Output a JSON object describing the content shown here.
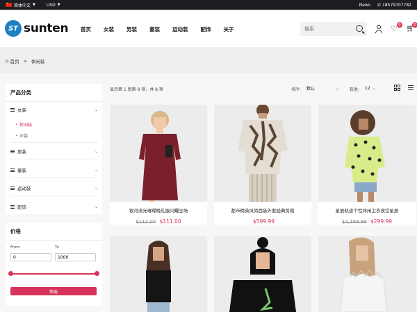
{
  "topbar": {
    "language": "简体中文",
    "currency": "USD",
    "news": "News",
    "phone": "18579707782"
  },
  "header": {
    "logo_mark": "ST",
    "logo_text": "sunten",
    "nav": [
      "首页",
      "女装",
      "男装",
      "童装",
      "运动装",
      "配饰",
      "关于"
    ],
    "search_placeholder": "搜索",
    "wishlist_count": "0",
    "cart_count": "0"
  },
  "breadcrumb": {
    "home": "首页",
    "separator": ">",
    "current": "休闲装"
  },
  "sidebar": {
    "categories_title": "产品分类",
    "categories": [
      {
        "label": "女装",
        "children": [
          {
            "label": "休闲装",
            "active": true
          },
          {
            "label": "正装",
            "active": false
          }
        ]
      },
      {
        "label": "男装"
      },
      {
        "label": "童装"
      },
      {
        "label": "运动装"
      },
      {
        "label": "配饰"
      }
    ],
    "price_title": "价格",
    "from_label": "From",
    "to_label": "To",
    "from_value": "0",
    "to_value": "1000",
    "filter_button": "筛选"
  },
  "toolbar": {
    "results_text": "显示第 1 到第 8 项，共 8 项",
    "sort_label": "排序:",
    "sort_value": "默认",
    "qty_label": "数量:",
    "qty_value": "12"
  },
  "products": [
    {
      "name": "银河流光璀璨晚礼服闪耀全场",
      "old_price": "$112.00",
      "price": "$111.00"
    },
    {
      "name": "都市精英风尚西装外套经典剪裁",
      "old_price": "",
      "price": "$599.99"
    },
    {
      "name": "星辰轨迹个性休闲卫衣夜空星辰",
      "old_price": "$2,199.99",
      "price": "$299.99"
    }
  ],
  "colors": {
    "accent": "#d6335a",
    "topbar_bg": "#1c1e22",
    "logo_blue": "#1e7fc3"
  }
}
